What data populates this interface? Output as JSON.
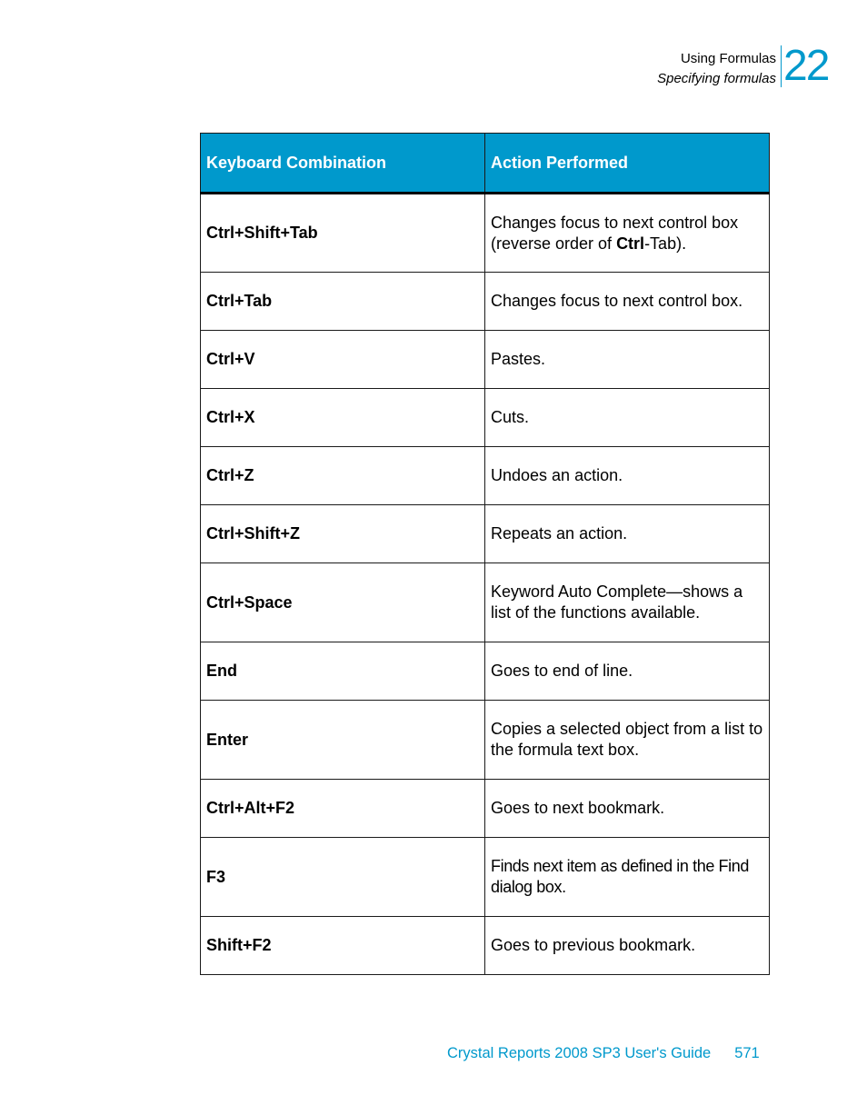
{
  "header": {
    "chapter_title": "Using Formulas",
    "section_title": "Specifying formulas",
    "chapter_number": "22"
  },
  "table": {
    "columns": [
      "Keyboard Combination",
      "Action Performed"
    ],
    "rows": [
      {
        "key": "Ctrl+Shift+Tab",
        "action_parts": [
          "Changes focus to next control box (reverse order of ",
          "Ctrl",
          "-Tab)."
        ]
      },
      {
        "key": "Ctrl+Tab",
        "action": "Changes focus to next control box."
      },
      {
        "key": "Ctrl+V",
        "action": "Pastes."
      },
      {
        "key": "Ctrl+X",
        "action": "Cuts."
      },
      {
        "key": "Ctrl+Z",
        "action": "Undoes an action."
      },
      {
        "key": "Ctrl+Shift+Z",
        "action": "Repeats an action."
      },
      {
        "key": "Ctrl+Space",
        "action": "Keyword Auto Complete—shows a list of the functions available."
      },
      {
        "key": "End",
        "action": "Goes to end of line."
      },
      {
        "key": "Enter",
        "action": "Copies a selected object from a list to the formula text box."
      },
      {
        "key": "Ctrl+Alt+F2",
        "action": "Goes to next bookmark."
      },
      {
        "key": "F3",
        "action": "Finds next item as defined in the Find dialog box."
      },
      {
        "key": "Shift+F2",
        "action": "Goes to previous bookmark."
      }
    ]
  },
  "footer": {
    "book_title": "Crystal Reports 2008 SP3 User's Guide",
    "page_number": "571"
  },
  "colors": {
    "accent": "#0099cc",
    "header_text": "#ffffff",
    "border": "#1a1a1a"
  }
}
